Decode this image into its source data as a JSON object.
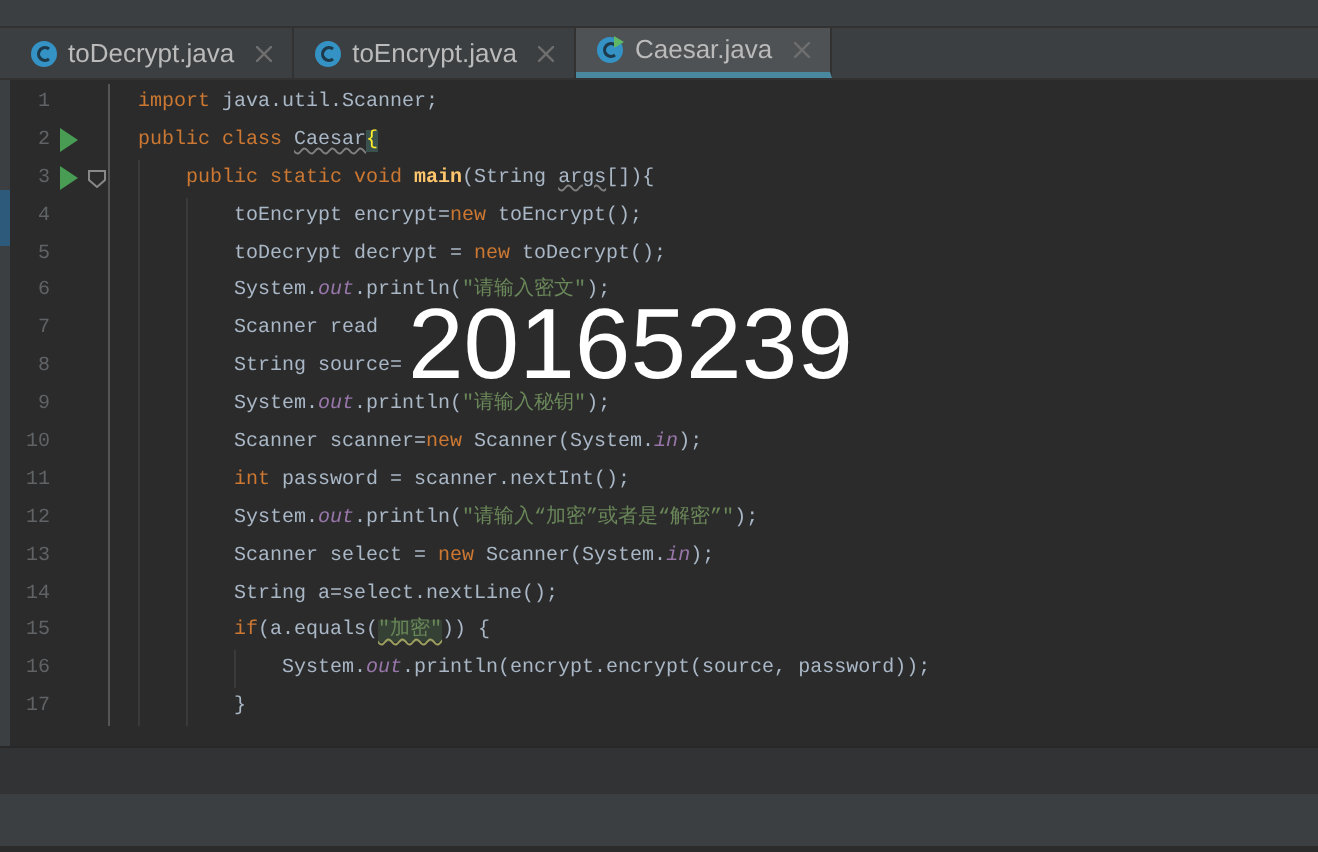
{
  "tabs": [
    {
      "label": "toDecrypt.java",
      "selected": false,
      "runnable": false
    },
    {
      "label": "toEncrypt.java",
      "selected": false,
      "runnable": false
    },
    {
      "label": "Caesar.java",
      "selected": true,
      "runnable": true
    }
  ],
  "editor": {
    "lines": [
      {
        "number": "1",
        "runnable": false,
        "foldable": false,
        "tokens": [
          {
            "kind": "kw",
            "text": "import"
          },
          {
            "kind": "plain",
            "text": " java.util.Scanner;"
          }
        ]
      },
      {
        "number": "2",
        "runnable": true,
        "foldable": false,
        "tokens": [
          {
            "kind": "kw",
            "text": "public class "
          },
          {
            "kind": "warn",
            "text": "Caesar"
          },
          {
            "kind": "brace",
            "text": "{"
          }
        ],
        "children": [
          {
            "number": "3",
            "runnable": true,
            "foldable": true,
            "tokens": [
              {
                "kind": "kw",
                "text": "public static void "
              },
              {
                "kind": "method",
                "text": "main"
              },
              {
                "kind": "plain",
                "text": "(String "
              },
              {
                "kind": "warn",
                "text": "args"
              },
              {
                "kind": "plain",
                "text": "[]){"
              }
            ],
            "children": [
              {
                "number": "4",
                "runnable": false,
                "foldable": false,
                "tokens": [
                  {
                    "kind": "plain",
                    "text": "toEncrypt encrypt="
                  },
                  {
                    "kind": "kw",
                    "text": "new"
                  },
                  {
                    "kind": "plain",
                    "text": " toEncrypt();"
                  }
                ]
              },
              {
                "number": "5",
                "runnable": false,
                "foldable": false,
                "tokens": [
                  {
                    "kind": "plain",
                    "text": "toDecrypt decrypt = "
                  },
                  {
                    "kind": "kw",
                    "text": "new"
                  },
                  {
                    "kind": "plain",
                    "text": " toDecrypt();"
                  }
                ]
              },
              {
                "number": "6",
                "runnable": false,
                "foldable": false,
                "tokens": [
                  {
                    "kind": "plain",
                    "text": "System."
                  },
                  {
                    "kind": "field",
                    "text": "out"
                  },
                  {
                    "kind": "plain",
                    "text": ".println("
                  },
                  {
                    "kind": "str",
                    "text": "\"请输入密文\""
                  },
                  {
                    "kind": "plain",
                    "text": ");"
                  }
                ]
              },
              {
                "number": "7",
                "runnable": false,
                "foldable": false,
                "tokens": [
                  {
                    "kind": "plain",
                    "text": "Scanner read"
                  }
                ]
              },
              {
                "number": "8",
                "runnable": false,
                "foldable": false,
                "tokens": [
                  {
                    "kind": "plain",
                    "text": "String source="
                  }
                ]
              },
              {
                "number": "9",
                "runnable": false,
                "foldable": false,
                "tokens": [
                  {
                    "kind": "plain",
                    "text": "System."
                  },
                  {
                    "kind": "field",
                    "text": "out"
                  },
                  {
                    "kind": "plain",
                    "text": ".println("
                  },
                  {
                    "kind": "str",
                    "text": "\"请输入秘钥\""
                  },
                  {
                    "kind": "plain",
                    "text": ");"
                  }
                ]
              },
              {
                "number": "10",
                "runnable": false,
                "foldable": false,
                "tokens": [
                  {
                    "kind": "plain",
                    "text": "Scanner scanner="
                  },
                  {
                    "kind": "kw",
                    "text": "new"
                  },
                  {
                    "kind": "plain",
                    "text": " Scanner(System."
                  },
                  {
                    "kind": "field",
                    "text": "in"
                  },
                  {
                    "kind": "plain",
                    "text": ");"
                  }
                ]
              },
              {
                "number": "11",
                "runnable": false,
                "foldable": false,
                "tokens": [
                  {
                    "kind": "kw",
                    "text": "int"
                  },
                  {
                    "kind": "plain",
                    "text": " password = scanner.nextInt();"
                  }
                ]
              },
              {
                "number": "12",
                "runnable": false,
                "foldable": false,
                "tokens": [
                  {
                    "kind": "plain",
                    "text": "System."
                  },
                  {
                    "kind": "field",
                    "text": "out"
                  },
                  {
                    "kind": "plain",
                    "text": ".println("
                  },
                  {
                    "kind": "str",
                    "text": "\"请输入“加密”或者是“解密”\""
                  },
                  {
                    "kind": "plain",
                    "text": ");"
                  }
                ]
              },
              {
                "number": "13",
                "runnable": false,
                "foldable": false,
                "tokens": [
                  {
                    "kind": "plain",
                    "text": "Scanner select = "
                  },
                  {
                    "kind": "kw",
                    "text": "new"
                  },
                  {
                    "kind": "plain",
                    "text": " Scanner(System."
                  },
                  {
                    "kind": "field",
                    "text": "in"
                  },
                  {
                    "kind": "plain",
                    "text": ");"
                  }
                ]
              },
              {
                "number": "14",
                "runnable": false,
                "foldable": false,
                "tokens": [
                  {
                    "kind": "plain",
                    "text": "String a=select.nextLine();"
                  }
                ]
              },
              {
                "number": "15",
                "runnable": false,
                "foldable": false,
                "tokens": [
                  {
                    "kind": "kw",
                    "text": "if"
                  },
                  {
                    "kind": "plain",
                    "text": "(a.equals("
                  },
                  {
                    "kind": "strhl",
                    "text": "\"加密\""
                  },
                  {
                    "kind": "plain",
                    "text": ")) {"
                  }
                ],
                "children": [
                  {
                    "number": "16",
                    "runnable": false,
                    "foldable": false,
                    "tokens": [
                      {
                        "kind": "plain",
                        "text": "System."
                      },
                      {
                        "kind": "field",
                        "text": "out"
                      },
                      {
                        "kind": "plain",
                        "text": ".println(encrypt.encrypt(source, password));"
                      }
                    ]
                  }
                ]
              },
              {
                "number": "17",
                "runnable": false,
                "foldable": false,
                "tokens": [
                  {
                    "kind": "plain",
                    "text": "}"
                  }
                ]
              }
            ]
          }
        ]
      }
    ]
  },
  "overlay_text": "20165239"
}
